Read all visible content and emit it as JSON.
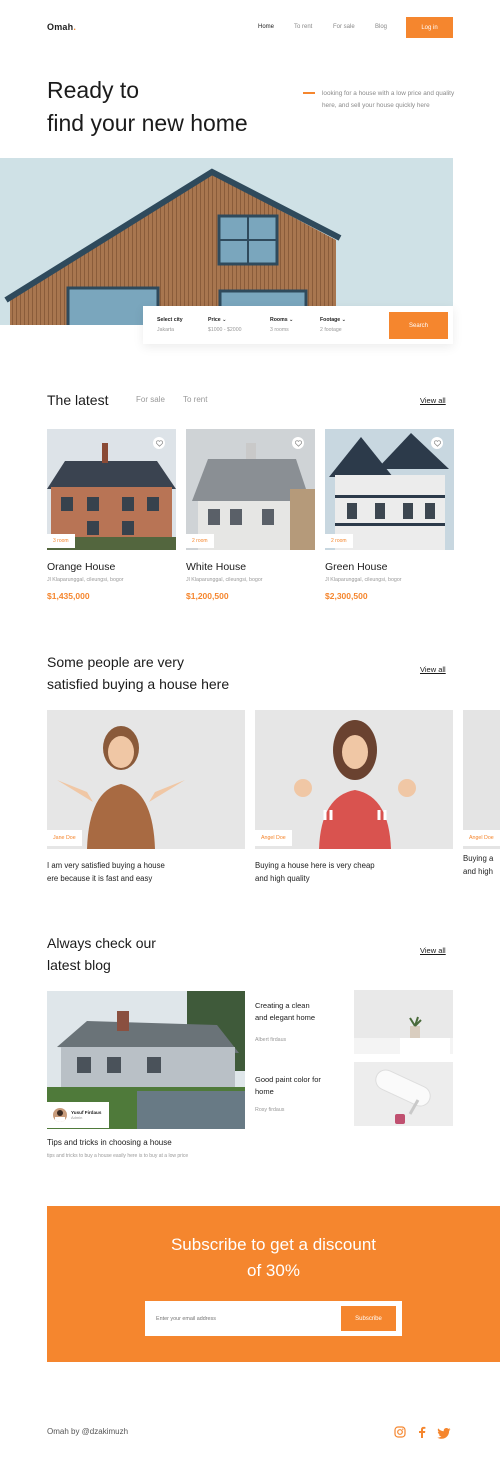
{
  "nav": {
    "logo": "Omah",
    "logo_dot": ".",
    "items": [
      "Home",
      "To rent",
      "For sale",
      "Blog"
    ],
    "login": "Log in"
  },
  "hero": {
    "title_line1": "Ready to",
    "title_line2": "find your new home",
    "description": "looking for a house with a low price and quality here, and sell your house quickly here"
  },
  "search": {
    "fields": [
      {
        "label": "Select city",
        "value": "Jakarta",
        "dropdown": false
      },
      {
        "label": "Price",
        "value": "$1000 - $2000",
        "dropdown": true
      },
      {
        "label": "Rooms",
        "value": "3 rooms",
        "dropdown": true
      },
      {
        "label": "Footage",
        "value": "2 footage",
        "dropdown": true
      }
    ],
    "button": "Search"
  },
  "latest": {
    "title": "The latest",
    "tabs": [
      "For sale",
      "To rent"
    ],
    "view_all": "View all",
    "houses": [
      {
        "rooms": "3 room",
        "name": "Orange House",
        "address": "Jl Klaparunggal, cileungsi, bogor",
        "price": "$1,435,000"
      },
      {
        "rooms": "2 room",
        "name": "White House",
        "address": "Jl Klaparunggal, cileungsi, bogor",
        "price": "$1,200,500"
      },
      {
        "rooms": "2 room",
        "name": "Green House",
        "address": "Jl Klaparunggal, cileungsi, bogor",
        "price": "$2,300,500"
      }
    ]
  },
  "testimonials": {
    "title_line1": "Some people are very",
    "title_line2": "satisfied buying a house here",
    "view_all": "View all",
    "items": [
      {
        "name": "Jane Doe",
        "quote_line1": "I am very satisfied buying a house",
        "quote_line2": "ere because it is fast and easy"
      },
      {
        "name": "Angel Doe",
        "quote_line1": "Buying a house here is very cheap",
        "quote_line2": "and high quality"
      },
      {
        "name": "Angel Doe",
        "quote_line1": "Buying a",
        "quote_line2": "and high"
      }
    ]
  },
  "blog": {
    "title_line1": "Always check our",
    "title_line2": "latest blog",
    "view_all": "View all",
    "main": {
      "author": "Yusuf Firdaus",
      "role": "Admin",
      "title": "Tips and tricks in choosing a house",
      "excerpt": "tips and tricks to buy a house easily here is to buy at a low price"
    },
    "side": [
      {
        "title_line1": "Creating a clean",
        "title_line2": "and elegant home",
        "author": "Albert firdaus"
      },
      {
        "title_line1": "Good paint color for",
        "title_line2": "home",
        "author": "Rosy firdaus"
      }
    ]
  },
  "subscribe": {
    "title_line1": "Subscribe to get a discount",
    "title_line2": "of 30%",
    "placeholder": "Enter your email address",
    "button": "Subscribe"
  },
  "footer": {
    "credit": "Omah by @dzakimuzh",
    "socials": [
      "instagram-icon",
      "facebook-icon",
      "twitter-icon"
    ]
  },
  "colors": {
    "accent": "#f5862e",
    "text": "#1b1b1b",
    "muted": "#999999"
  }
}
